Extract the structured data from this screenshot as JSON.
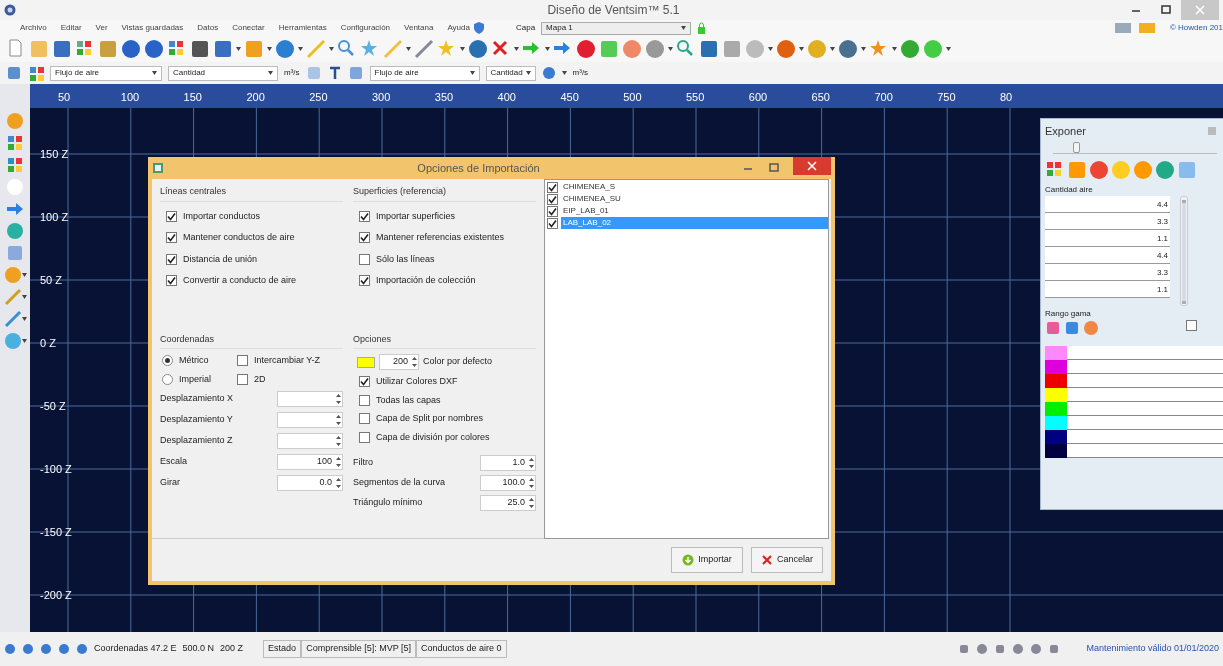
{
  "window": {
    "title": "Diseño de Ventsim™ 5.1"
  },
  "menu": [
    "Archivo",
    "Editar",
    "Ver",
    "Vistas guardadas",
    "Datos",
    "Conectar",
    "Herramientas",
    "Configuración",
    "Ventana",
    "Ayuda"
  ],
  "layer": {
    "label": "Capa",
    "value": "Mapa 1"
  },
  "copyright": "© Howden 201",
  "toolbar2": {
    "field_1": "Flujo de aire",
    "field_2": "Cantidad",
    "unit_1": "m³/s",
    "field_3": "Flujo de aire",
    "field_4": "Cantidad",
    "unit_2": "m³/s"
  },
  "canvas": {
    "x_labels": [
      "50",
      "100",
      "150",
      "200",
      "250",
      "300",
      "350",
      "400",
      "450",
      "500",
      "550",
      "600",
      "650",
      "700",
      "750",
      "80"
    ],
    "y_labels": [
      "150 Z",
      "100 Z",
      "50 Z",
      "0 Z",
      "-50 Z",
      "-100 Z",
      "-150 Z",
      "-200 Z"
    ]
  },
  "dialog": {
    "title": "Opciones de Importación",
    "centerlines": {
      "heading": "Líneas centrales",
      "options": [
        {
          "label": "Importar conductos",
          "checked": true
        },
        {
          "label": "Mantener conductos de aire",
          "checked": true
        },
        {
          "label": "Distancia de unión",
          "checked": true
        },
        {
          "label": "Convertir a conducto de aire",
          "checked": true
        }
      ]
    },
    "surfaces": {
      "heading": "Superficies (referencia)",
      "options": [
        {
          "label": "Importar superficies",
          "checked": true
        },
        {
          "label": "Mantener referencias existentes",
          "checked": true
        },
        {
          "label": "Sólo las líneas",
          "checked": false
        },
        {
          "label": "Importación de colección",
          "checked": true
        }
      ]
    },
    "coordinates": {
      "heading": "Coordenadas",
      "units": [
        {
          "label": "Métrico",
          "selected": true
        },
        {
          "label": "Imperial",
          "selected": false
        }
      ],
      "flags": [
        {
          "label": "Intercambiar Y-Z",
          "checked": false
        },
        {
          "label": "2D",
          "checked": false
        }
      ],
      "fields": [
        {
          "label": "Desplazamiento X"
        },
        {
          "label": "Desplazamiento Y"
        },
        {
          "label": "Desplazamiento Z"
        },
        {
          "label": "Escala",
          "value": "100"
        },
        {
          "label": "Girar",
          "value": "0.0"
        }
      ]
    },
    "options": {
      "heading": "Opciones",
      "color": {
        "color": "#ffff00",
        "value": "200",
        "label": "Color por defecto"
      },
      "checks": [
        {
          "label": "Utilizar Colores DXF",
          "checked": true
        },
        {
          "label": "Todas las capas",
          "checked": false
        },
        {
          "label": "Capa de Split por nombres",
          "checked": false
        },
        {
          "label": "Capa de división por colores",
          "checked": false
        }
      ],
      "fields": [
        {
          "label": "Filtro",
          "value": "1.0"
        },
        {
          "label": "Segmentos de la curva",
          "value": "100.0"
        },
        {
          "label": "Triángulo mínimo",
          "value": "25.0"
        }
      ]
    },
    "layers": [
      {
        "label": "CHIMENEA_S",
        "checked": true,
        "selected": false
      },
      {
        "label": "CHIMENEA_SU",
        "checked": true,
        "selected": false
      },
      {
        "label": "EIP_LAB_01",
        "checked": true,
        "selected": false
      },
      {
        "label": "LAB_LAB_02",
        "checked": true,
        "selected": true
      }
    ],
    "buttons": [
      {
        "label": "Importar",
        "kind": "import"
      },
      {
        "label": "Cancelar",
        "kind": "cancel"
      }
    ]
  },
  "panel": {
    "title": "Exponer",
    "slider": {
      "level": 0.12
    },
    "label": "Cantidad aire",
    "values": [
      "4.4",
      "3.3",
      "1.1",
      "4.4",
      "3.3",
      "1.1"
    ],
    "range_slider": {
      "level": 1
    },
    "range_label": "Rango gama",
    "checkbox": {
      "checked": false
    },
    "legend": [
      {
        "color": "#ff88ff"
      },
      {
        "color": "#dd00dd"
      },
      {
        "color": "#ee0000"
      },
      {
        "color": "#ffff00"
      },
      {
        "color": "#00ee00"
      },
      {
        "color": "#00ffff"
      },
      {
        "color": "#000080"
      },
      {
        "color": "#000040"
      }
    ]
  },
  "status_bar": {
    "coordinates": [
      "Coordenadas 47.2 E",
      "500.0 N",
      "200 Z"
    ],
    "panes": [
      "Estado",
      "Comprensible [5]: MVP [5]",
      "Conductos de aire 0"
    ],
    "license": "Mantenimiento válido 01/01/2020"
  }
}
